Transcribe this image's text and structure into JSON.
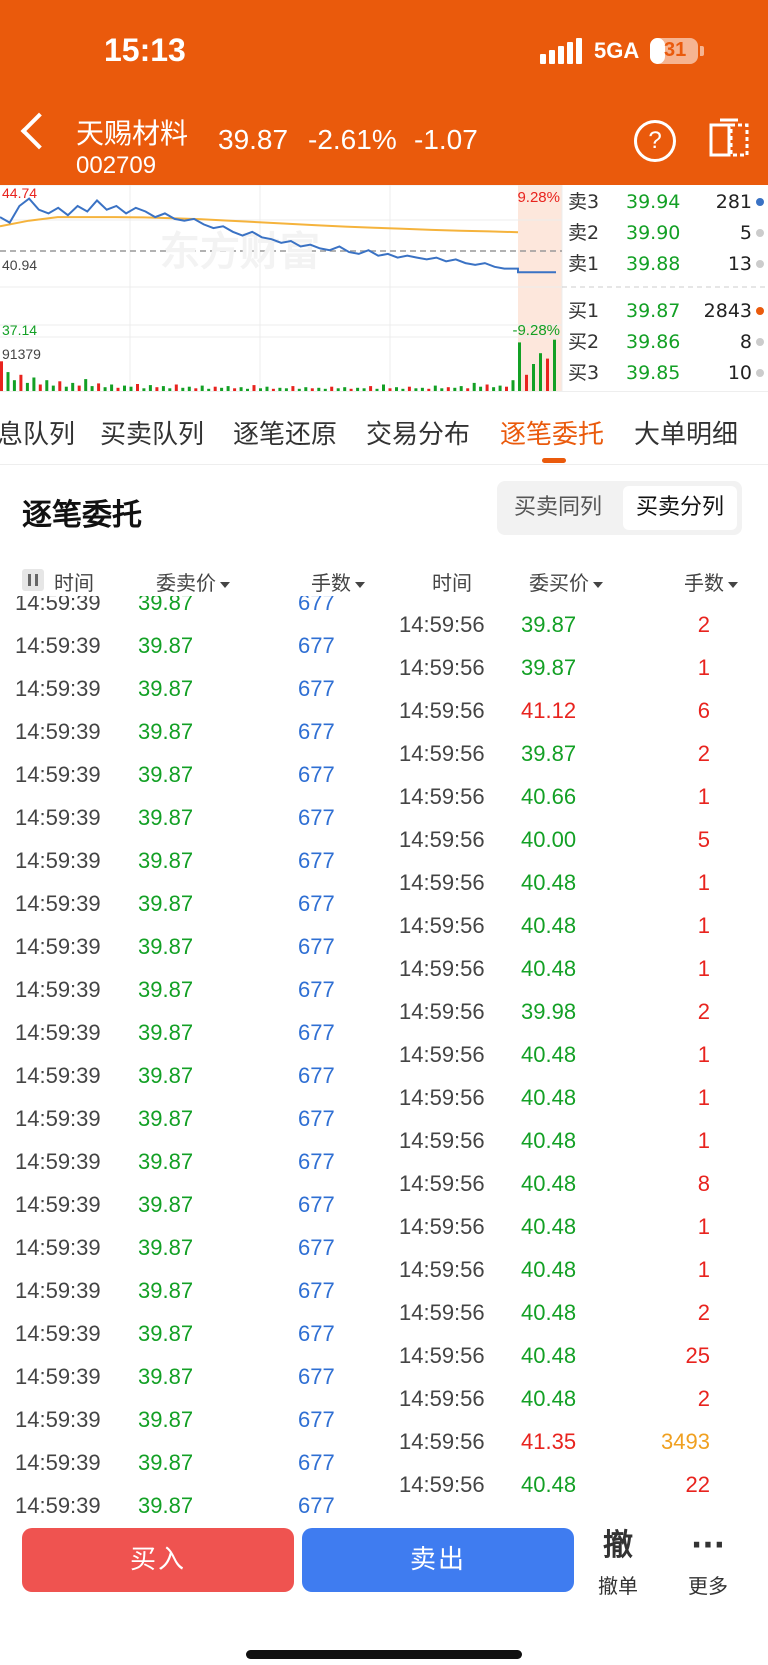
{
  "status_bar": {
    "time": "15:13",
    "network": "5GA",
    "battery": "31",
    "battery_level": 0.31
  },
  "header": {
    "stock_name": "天赐材料",
    "stock_code": "002709",
    "price": "39.87",
    "pct_change": "-2.61%",
    "change": "-1.07"
  },
  "colors": {
    "brand": "#ea5a0c",
    "up_red": "#e8231e",
    "down_green": "#13a025",
    "volume_blue": "#2f6fd3",
    "highlight_orange": "#f0a020",
    "buy_button": "#ef5350",
    "sell_button": "#3f7cf0"
  },
  "chart": {
    "high_price": "44.74",
    "prev_close": "40.94",
    "low_price": "37.14",
    "high_pct": "9.28%",
    "low_pct": "-9.28%",
    "volume_max": "91379",
    "watermark": "东方财富",
    "price_line": [
      43.0,
      42.7,
      43.6,
      44.0,
      43.4,
      43.2,
      43.5,
      43.1,
      43.6,
      43.3,
      43.9,
      43.4,
      43.6,
      43.2,
      43.5,
      43.3,
      43.0,
      43.2,
      42.9,
      42.8,
      42.9,
      42.6,
      42.4,
      42.5,
      42.2,
      42.0,
      42.2,
      41.9,
      41.8,
      41.6,
      41.7,
      41.4,
      41.5,
      41.3,
      41.2,
      41.4,
      41.1,
      41.0,
      41.2,
      40.9,
      41.0,
      40.8,
      40.9,
      40.8,
      40.7,
      40.8,
      40.6,
      40.7,
      40.5,
      40.4,
      40.5,
      40.3,
      40.2,
      40.2
    ],
    "avg_line": [
      42.5,
      42.8,
      43.0,
      43.0,
      43.0,
      42.98,
      42.94,
      42.88,
      42.8,
      42.72,
      42.64,
      42.56,
      42.48,
      42.42,
      42.36,
      42.3,
      42.26,
      42.22,
      42.18
    ],
    "volume_bars": [
      0.55,
      0.35,
      0.2,
      0.3,
      0.15,
      0.25,
      0.12,
      0.2,
      0.1,
      0.18,
      0.08,
      0.15,
      0.1,
      0.22,
      0.09,
      0.14,
      0.07,
      0.12,
      0.06,
      0.1,
      0.08,
      0.13,
      0.05,
      0.11,
      0.07,
      0.09,
      0.05,
      0.12,
      0.06,
      0.08,
      0.05,
      0.1,
      0.04,
      0.08,
      0.06,
      0.09,
      0.05,
      0.07,
      0.04,
      0.11,
      0.05,
      0.08,
      0.04,
      0.06,
      0.05,
      0.09,
      0.04,
      0.07,
      0.05,
      0.06,
      0.04,
      0.08,
      0.05,
      0.07,
      0.04,
      0.06,
      0.05,
      0.09,
      0.04,
      0.12,
      0.05,
      0.07,
      0.04,
      0.08,
      0.05,
      0.06,
      0.04,
      0.1,
      0.05,
      0.07,
      0.06,
      0.09,
      0.05,
      0.15,
      0.08,
      0.12,
      0.07,
      0.1,
      0.08,
      0.2,
      0.9,
      0.3,
      0.5,
      0.7,
      0.6,
      0.95
    ]
  },
  "order_book": {
    "asks": [
      {
        "label": "卖3",
        "price": "39.94",
        "vol": "281"
      },
      {
        "label": "卖2",
        "price": "39.90",
        "vol": "5"
      },
      {
        "label": "卖1",
        "price": "39.88",
        "vol": "13"
      }
    ],
    "bids": [
      {
        "label": "买1",
        "price": "39.87",
        "vol": "2843"
      },
      {
        "label": "买2",
        "price": "39.86",
        "vol": "8"
      },
      {
        "label": "买3",
        "price": "39.85",
        "vol": "10"
      }
    ]
  },
  "tabs": [
    {
      "label": "息队列"
    },
    {
      "label": "买卖队列"
    },
    {
      "label": "逐笔还原"
    },
    {
      "label": "交易分布"
    },
    {
      "label": "逐笔委托",
      "active": true
    },
    {
      "label": "大单明细"
    }
  ],
  "section": {
    "title": "逐笔委托",
    "toggle_same": "买卖同列",
    "toggle_split": "买卖分列"
  },
  "columns": {
    "time": "时间",
    "sell_price": "委卖价",
    "lots": "手数",
    "buy_price": "委买价"
  },
  "sell_orders": [
    {
      "time": "14:59:39",
      "price": "39.87",
      "lots": "677"
    },
    {
      "time": "14:59:39",
      "price": "39.87",
      "lots": "677"
    },
    {
      "time": "14:59:39",
      "price": "39.87",
      "lots": "677"
    },
    {
      "time": "14:59:39",
      "price": "39.87",
      "lots": "677"
    },
    {
      "time": "14:59:39",
      "price": "39.87",
      "lots": "677"
    },
    {
      "time": "14:59:39",
      "price": "39.87",
      "lots": "677"
    },
    {
      "time": "14:59:39",
      "price": "39.87",
      "lots": "677"
    },
    {
      "time": "14:59:39",
      "price": "39.87",
      "lots": "677"
    },
    {
      "time": "14:59:39",
      "price": "39.87",
      "lots": "677"
    },
    {
      "time": "14:59:39",
      "price": "39.87",
      "lots": "677"
    },
    {
      "time": "14:59:39",
      "price": "39.87",
      "lots": "677"
    },
    {
      "time": "14:59:39",
      "price": "39.87",
      "lots": "677"
    },
    {
      "time": "14:59:39",
      "price": "39.87",
      "lots": "677"
    },
    {
      "time": "14:59:39",
      "price": "39.87",
      "lots": "677"
    },
    {
      "time": "14:59:39",
      "price": "39.87",
      "lots": "677"
    },
    {
      "time": "14:59:39",
      "price": "39.87",
      "lots": "677"
    },
    {
      "time": "14:59:39",
      "price": "39.87",
      "lots": "677"
    },
    {
      "time": "14:59:39",
      "price": "39.87",
      "lots": "677"
    },
    {
      "time": "14:59:39",
      "price": "39.87",
      "lots": "677"
    },
    {
      "time": "14:59:39",
      "price": "39.87",
      "lots": "677"
    },
    {
      "time": "14:59:39",
      "price": "39.87",
      "lots": "677"
    },
    {
      "time": "14:59:39",
      "price": "39.87",
      "lots": "677"
    },
    {
      "time": "14:59:39",
      "price": "39.87",
      "lots": "677"
    }
  ],
  "buy_orders": [
    {
      "time": "14:59:56",
      "price": "39.87",
      "lots": "2"
    },
    {
      "time": "14:59:56",
      "price": "39.87",
      "lots": "1"
    },
    {
      "time": "14:59:56",
      "price": "41.12",
      "lots": "6",
      "price_up": true
    },
    {
      "time": "14:59:56",
      "price": "39.87",
      "lots": "2"
    },
    {
      "time": "14:59:56",
      "price": "40.66",
      "lots": "1"
    },
    {
      "time": "14:59:56",
      "price": "40.00",
      "lots": "5"
    },
    {
      "time": "14:59:56",
      "price": "40.48",
      "lots": "1"
    },
    {
      "time": "14:59:56",
      "price": "40.48",
      "lots": "1"
    },
    {
      "time": "14:59:56",
      "price": "40.48",
      "lots": "1"
    },
    {
      "time": "14:59:56",
      "price": "39.98",
      "lots": "2"
    },
    {
      "time": "14:59:56",
      "price": "40.48",
      "lots": "1"
    },
    {
      "time": "14:59:56",
      "price": "40.48",
      "lots": "1"
    },
    {
      "time": "14:59:56",
      "price": "40.48",
      "lots": "1"
    },
    {
      "time": "14:59:56",
      "price": "40.48",
      "lots": "8"
    },
    {
      "time": "14:59:56",
      "price": "40.48",
      "lots": "1"
    },
    {
      "time": "14:59:56",
      "price": "40.48",
      "lots": "1"
    },
    {
      "time": "14:59:56",
      "price": "40.48",
      "lots": "2"
    },
    {
      "time": "14:59:56",
      "price": "40.48",
      "lots": "25"
    },
    {
      "time": "14:59:56",
      "price": "40.48",
      "lots": "2"
    },
    {
      "time": "14:59:56",
      "price": "41.35",
      "lots": "3493",
      "price_up": true,
      "big": true
    },
    {
      "time": "14:59:56",
      "price": "40.48",
      "lots": "22"
    }
  ],
  "bottom_bar": {
    "buy": "买入",
    "sell": "卖出",
    "cancel_icon": "撤",
    "cancel": "撤单",
    "more_icon": "···",
    "more": "更多"
  }
}
